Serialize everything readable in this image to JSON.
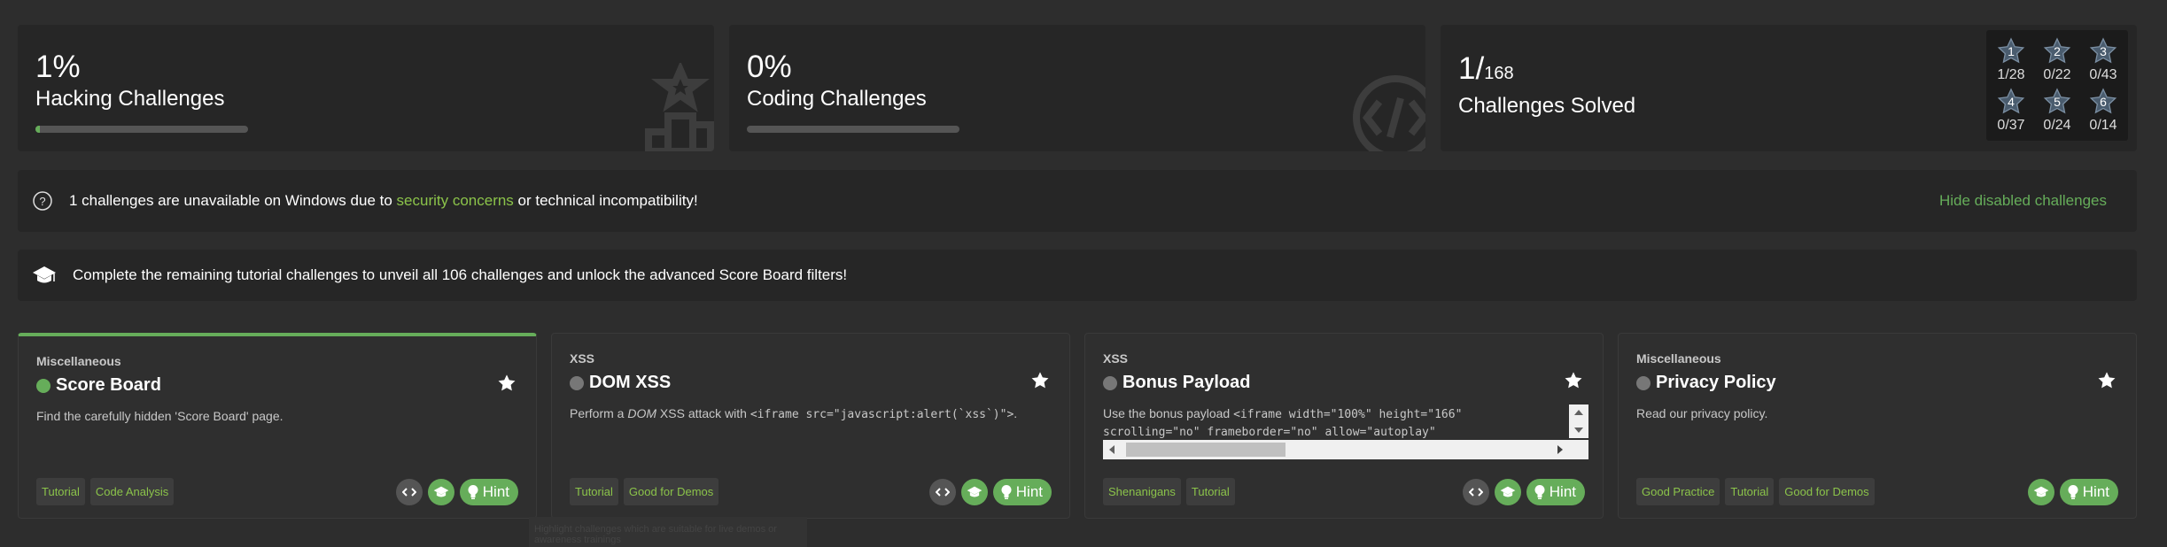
{
  "hacking": {
    "percent": "1%",
    "label": "Hacking Challenges",
    "progress": 0.01
  },
  "coding": {
    "percent": "0%",
    "label": "Coding Challenges",
    "progress": 0
  },
  "solved": {
    "count": "1/",
    "total": "168",
    "label": "Challenges Solved",
    "difficulties": [
      {
        "level": "1",
        "count": "1/28"
      },
      {
        "level": "2",
        "count": "0/22"
      },
      {
        "level": "3",
        "count": "0/43"
      },
      {
        "level": "4",
        "count": "0/37"
      },
      {
        "level": "5",
        "count": "0/24"
      },
      {
        "level": "6",
        "count": "0/14"
      }
    ]
  },
  "notice": {
    "text_before": "1 challenges are unavailable on Windows due to ",
    "link": "security concerns",
    "text_after": " or technical incompatibility!",
    "hide_link": "Hide disabled challenges"
  },
  "tutorial_notice": "Complete the remaining tutorial challenges to unveil all 106 challenges and unlock the advanced Score Board filters!",
  "challenges": [
    {
      "category": "Miscellaneous",
      "title": "Score Board",
      "description": "Find the carefully hidden 'Score Board' page.",
      "tags": [
        "Tutorial",
        "Code Analysis"
      ],
      "hint": "Hint",
      "solved": true
    },
    {
      "category": "XSS",
      "title": "DOM XSS",
      "description_prefix": "Perform a ",
      "description_em": "DOM",
      "description_mid": " XSS attack with ",
      "description_code": "<iframe src=\"javascript:alert(`xss`)\">",
      "description_suffix": ".",
      "tags": [
        "Tutorial",
        "Good for Demos"
      ],
      "hint": "Hint",
      "solved": false
    },
    {
      "category": "XSS",
      "title": "Bonus Payload",
      "description_prefix": "Use the bonus payload ",
      "code_line1": "<iframe width=\"100%\" height=\"166\"",
      "code_line2": "scrolling=\"no\" frameborder=\"no\" allow=\"autoplay\"",
      "tags": [
        "Shenanigans",
        "Tutorial"
      ],
      "hint": "Hint",
      "solved": false
    },
    {
      "category": "Miscellaneous",
      "title": "Privacy Policy",
      "description": "Read our privacy policy.",
      "tags": [
        "Good Practice",
        "Tutorial",
        "Good for Demos"
      ],
      "hint": "Hint",
      "solved": false
    }
  ],
  "tooltip_ghost": "Highlight challenges which are suitable for live demos or awareness trainings",
  "colors": {
    "accent": "#66ad5a",
    "link": "#8bc34a",
    "bg": "#2d2d2d",
    "card": "#262626"
  }
}
